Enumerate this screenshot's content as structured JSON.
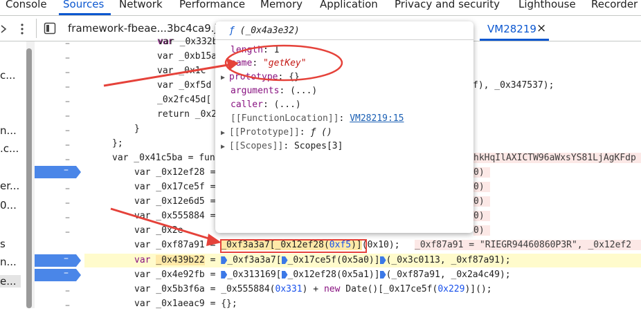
{
  "top_tabs": [
    "Console",
    "Sources",
    "Network",
    "Performance",
    "Memory",
    "Application",
    "Privacy and security",
    "Lighthouse",
    "Recorder"
  ],
  "file_tabs": {
    "file1": "framework-fbeae...3bc4ca9.js",
    "file2": "VM28219",
    "close": "×"
  },
  "left_nav": [
    "c...",
    "n...",
    ".c...",
    "er...",
    "0...",
    "s",
    "n...",
    "e..."
  ],
  "code": {
    "l1": "var _0x332b",
    "l2": "var _0xb15a",
    "l3": "var _0x1c",
    "l4a": "var _0xf5d",
    "l4b": "f), _0x347537);",
    "l5": "_0x2fc45d[",
    "l6": "return _0x2",
    "l7": "}",
    "l8": "};",
    "l9": "var _0x41c5ba = fun",
    "l9b": "hkHqIlAXICTW96aWxsYS81LjAgKFdp",
    "l10": "var _0x12ef28 =",
    "l11": "var _0x17ce5f =",
    "l12": "var _0x12e6d5 =",
    "l13": "var _0x555884 =",
    "l14": "var _0x2e",
    "inline_vals": [
      "0)",
      "0)",
      "0)",
      "0)",
      "0)"
    ],
    "l15": {
      "decl": "var _0xf87a91 = ",
      "expr_a": "_0xf3a3a7[_0x12ef28(",
      "expr_num": "0xf5",
      "expr_b": ")]",
      "tail": "(0x10);",
      "inline": "_0xf87a91 = \"RIEGR94460860P3R\", _0x12ef2"
    },
    "l16": {
      "decl": "var ",
      "name": "_0x439b22",
      "rest_a": " = ",
      "rest_b": "_0xf3a3a7[",
      "rest_c": "_0x17ce5f(0x5a0)]",
      "rest_d": "(_0x3c0113, _0xf87a91);"
    },
    "l17": {
      "decl": "var _0x4e92fb = ",
      "a": "_0x313169[",
      "b": "_0x12ef28(0x5a1)]",
      "c": "(_0xf87a91, _0x2a4c49);"
    },
    "l18": {
      "a": "var _0x5b3f6a = _0x555884(",
      "num": "0x331",
      "b": ") + ",
      "kw": "new",
      "c": " Date()[_0x17ce5f(",
      "num2": "0x229",
      "d": ")]();"
    },
    "l19": "var _0x1aeac9 = {};"
  },
  "gutter_marks": [
    "–",
    "–",
    "–",
    "–",
    "–",
    "–",
    "–",
    "–",
    "–",
    "–",
    "–",
    "–",
    "–",
    "–",
    "–",
    "–",
    "–",
    "–",
    "–"
  ],
  "breakpoint_labels": [
    "–",
    "–",
    "–"
  ],
  "popover": {
    "title_f": "ƒ",
    "title": "_0x4a3e32)",
    "length_key": "length",
    "length_val": "1",
    "name_key": "name",
    "name_val": "\"getKey\"",
    "prototype_key": "prototype",
    "prototype_val": "{}",
    "arguments_key": "arguments",
    "arguments_val": "(...)",
    "caller_key": "caller",
    "caller_val": "(...)",
    "fnloc_key": "[[FunctionLocation]]",
    "fnloc_val": "VM28219:15",
    "proto_key": "[[Prototype]]",
    "proto_val": "ƒ ()",
    "scopes_key": "[[Scopes]]",
    "scopes_val": "Scopes[3]"
  },
  "colors": {
    "accent": "#0b57d0",
    "annotation": "#e5423a",
    "breakpoint": "#4a86e8"
  }
}
